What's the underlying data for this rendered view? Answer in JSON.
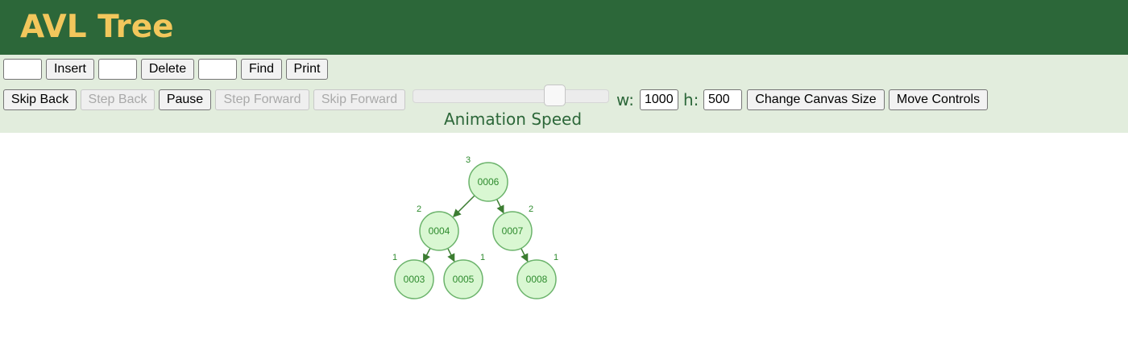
{
  "header": {
    "title": "AVL Tree"
  },
  "toolbar": {
    "insert_value": "",
    "insert_label": "Insert",
    "delete_value": "",
    "delete_label": "Delete",
    "find_value": "",
    "find_label": "Find",
    "print_label": "Print"
  },
  "animation": {
    "skip_back": "Skip Back",
    "step_back": "Step Back",
    "pause": "Pause",
    "step_forward": "Step Forward",
    "skip_forward": "Skip Forward",
    "speed_label": "Animation Speed",
    "speed_fraction": 0.75
  },
  "canvas": {
    "w_label": "w:",
    "w_value": "1000",
    "h_label": "h:",
    "h_value": "500",
    "change_size_label": "Change Canvas Size",
    "move_controls_label": "Move Controls"
  },
  "colors": {
    "header_bg": "#2c6739",
    "title": "#f2c75c",
    "controls_bg": "#e2eddd",
    "node_fill": "#d9f7d2",
    "node_stroke": "#6bb36b",
    "edge": "#3c7d32",
    "node_text": "#2e8b2e"
  },
  "tree": {
    "nodes": [
      {
        "id": "n6",
        "label": "0006",
        "height": "3"
      },
      {
        "id": "n4",
        "label": "0004",
        "height": "2"
      },
      {
        "id": "n7",
        "label": "0007",
        "height": "2"
      },
      {
        "id": "n3",
        "label": "0003",
        "height": "1"
      },
      {
        "id": "n5",
        "label": "0005",
        "height": "1"
      },
      {
        "id": "n8",
        "label": "0008",
        "height": "1"
      }
    ],
    "edges": [
      {
        "from": "n6",
        "to": "n4"
      },
      {
        "from": "n6",
        "to": "n7"
      },
      {
        "from": "n4",
        "to": "n3"
      },
      {
        "from": "n4",
        "to": "n5"
      },
      {
        "from": "n7",
        "to": "n8"
      }
    ]
  }
}
